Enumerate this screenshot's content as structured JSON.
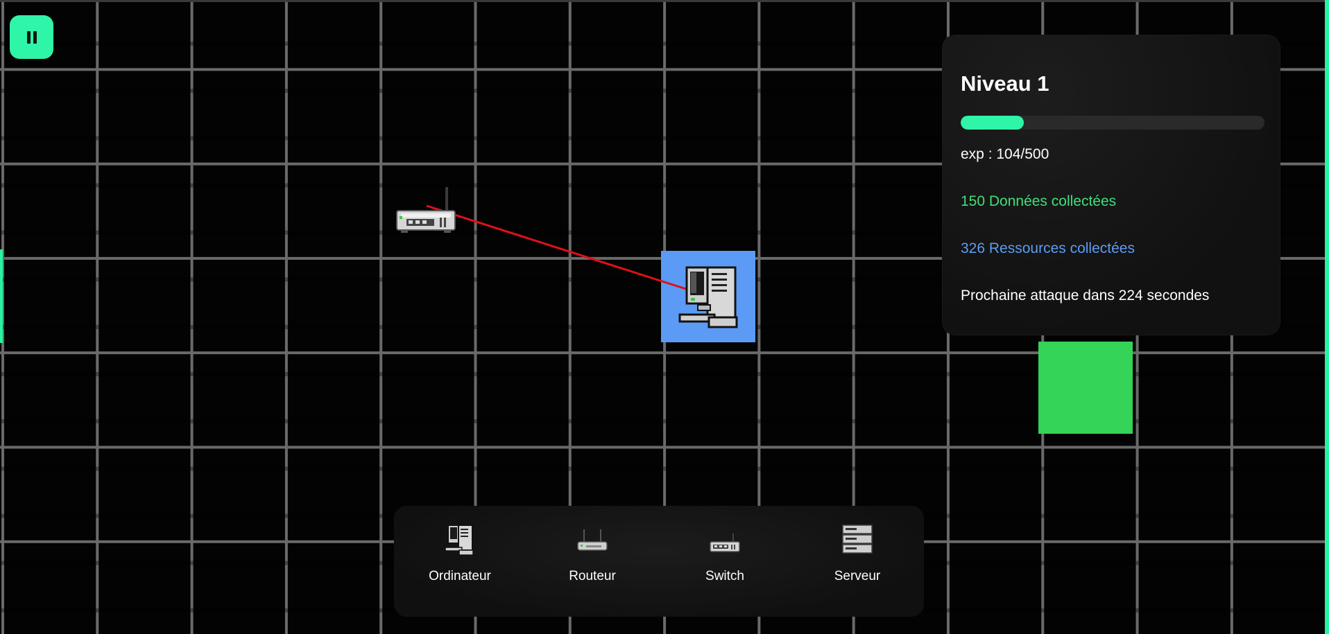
{
  "game": {
    "pause_icon": "pause-icon"
  },
  "stats": {
    "level_title": "Niveau 1",
    "exp_progress": 0.208,
    "exp_text": "exp : 104/500",
    "data_text": "150 Données collectées",
    "resources_text": "326 Ressources collectées",
    "attack_text": "Prochaine attaque dans 224 secondes"
  },
  "colors": {
    "accent": "#2ef5a8",
    "selected_cell": "#5b9bf5",
    "target_cell": "#33d457",
    "data_text": "#3ee07a",
    "resources_text": "#5d9cf2",
    "link": "#e0101a"
  },
  "toolbar": {
    "items": [
      {
        "label": "Ordinateur",
        "icon": "computer-icon"
      },
      {
        "label": "Routeur",
        "icon": "router-icon"
      },
      {
        "label": "Switch",
        "icon": "switch-icon"
      },
      {
        "label": "Serveur",
        "icon": "server-icon"
      }
    ]
  }
}
